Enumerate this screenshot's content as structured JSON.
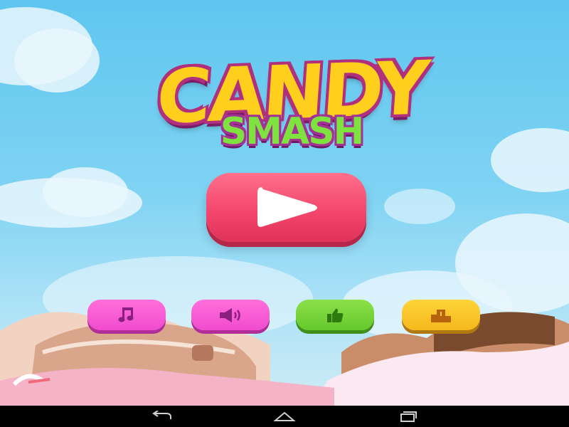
{
  "title": {
    "line1": "CANDY",
    "line2": "SMASH"
  },
  "colors": {
    "sky_top": "#5fc6ef",
    "play": "#f2446a",
    "music": "#f04bcf",
    "sound": "#f04bcf",
    "like": "#65c82b",
    "leaderboard": "#f5b81c",
    "icon_on_pink": "#8a1f80",
    "icon_on_green": "#2f7a10",
    "icon_on_yellow": "#b8640f"
  },
  "buttons": [
    {
      "name": "play-button",
      "icon": "play-icon"
    },
    {
      "name": "music-button",
      "icon": "music-note-icon"
    },
    {
      "name": "sound-button",
      "icon": "speaker-icon"
    },
    {
      "name": "like-button",
      "icon": "thumbs-up-icon"
    },
    {
      "name": "leaderboard-button",
      "icon": "podium-icon"
    }
  ],
  "navbar": {
    "icons": [
      "back-icon",
      "home-icon",
      "recent-apps-icon"
    ]
  }
}
